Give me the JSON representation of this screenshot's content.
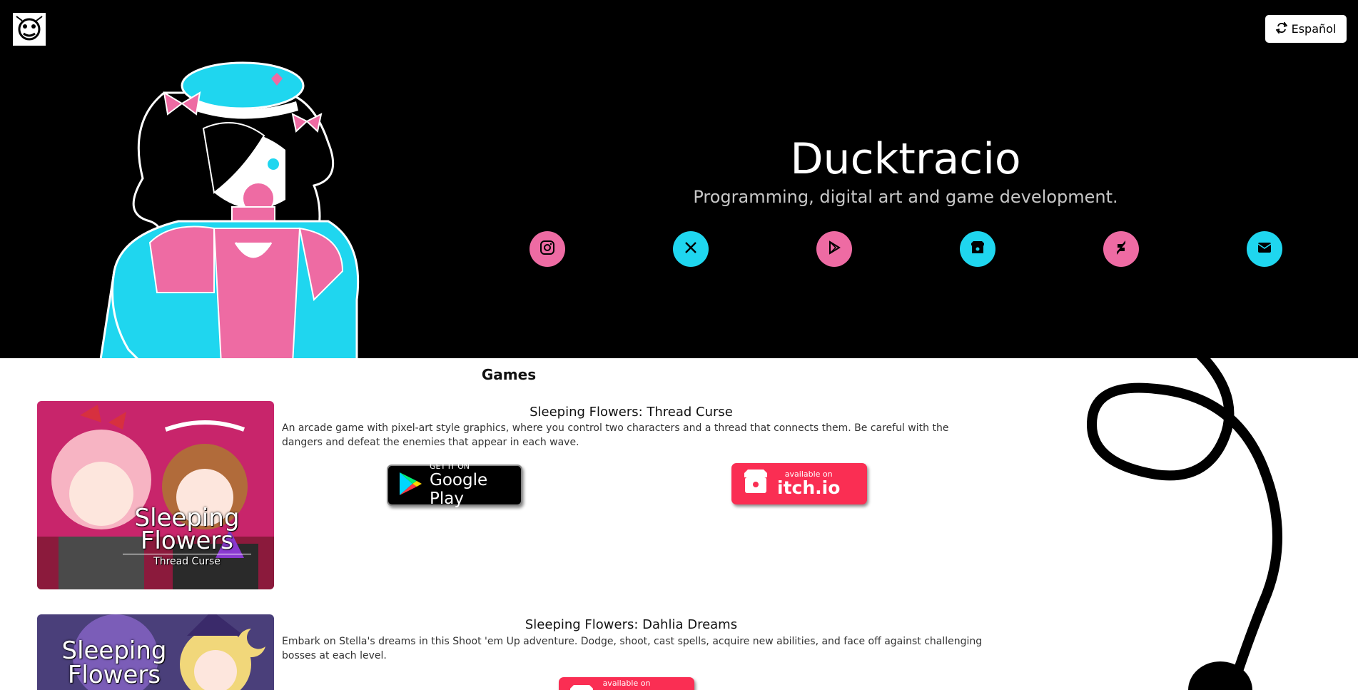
{
  "header": {
    "lang_button": "Español"
  },
  "hero": {
    "title": "Ducktracio",
    "subtitle": "Programming, digital art and game development.",
    "socials": [
      {
        "icon": "instagram-icon",
        "color": "#ee6ba3"
      },
      {
        "icon": "x-icon",
        "color": "#1fd6ef"
      },
      {
        "icon": "google-play-icon",
        "color": "#ee6ba3"
      },
      {
        "icon": "itch-icon",
        "color": "#1fd6ef"
      },
      {
        "icon": "deviantart-icon",
        "color": "#ee6ba3"
      },
      {
        "icon": "envelope-icon",
        "color": "#1fd6ef"
      }
    ]
  },
  "games": {
    "heading": "Games",
    "items": [
      {
        "title": "Sleeping Flowers: Thread Curse",
        "description": "An arcade game with pixel-art style graphics, where you control two characters and a thread that connects them. Be careful with the dangers and defeat the enemies that appear in each wave.",
        "cover_title_1": "Sleeping",
        "cover_title_2": "Flowers",
        "cover_subtitle": "Thread Curse",
        "google_play": {
          "small": "GET IT ON",
          "big": "Google Play"
        },
        "itch": {
          "small": "available on",
          "big": "itch.io"
        }
      },
      {
        "title": "Sleeping Flowers: Dahlia Dreams",
        "description": "Embark on Stella's dreams in this Shoot 'em Up adventure. Dodge, shoot, cast spells, acquire new abilities, and face off against challenging bosses at each level.",
        "cover_title_1": "Sleeping",
        "cover_title_2": "Flowers",
        "itch": {
          "small": "available on"
        }
      }
    ]
  }
}
